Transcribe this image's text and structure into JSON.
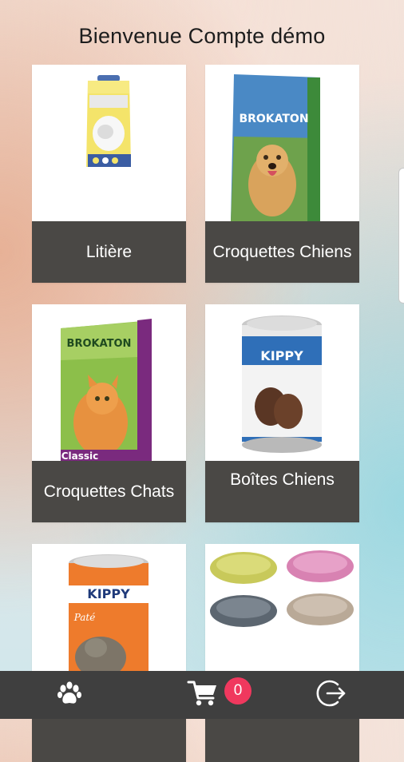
{
  "header": {
    "title": "Bienvenue Compte démo"
  },
  "categories": [
    {
      "label": "Litière",
      "image": "cat-litter-bag"
    },
    {
      "label": "Croquettes Chiens",
      "image": "dog-food-bag-brokaton"
    },
    {
      "label": "Croquettes Chats",
      "image": "cat-food-bag-brokaton"
    },
    {
      "label": "Boîtes Chiens",
      "image": "dog-food-can-kippy"
    },
    {
      "label": "",
      "image": "cat-food-can-kippy"
    },
    {
      "label": "",
      "image": "plastic-pet-baskets"
    }
  ],
  "images_text": {
    "brokaton": "BROKATON",
    "kippy": "KIPPY",
    "classic": "Classic",
    "pate": "Paté"
  },
  "bottom_bar": {
    "paw_icon": "paw-icon",
    "cart_icon": "cart-icon",
    "cart_count": "0",
    "logout_icon": "logout-icon"
  },
  "colors": {
    "label_background": "#4a4845",
    "bottom_bar": "#3f3f3f",
    "badge": "#f0385e"
  }
}
